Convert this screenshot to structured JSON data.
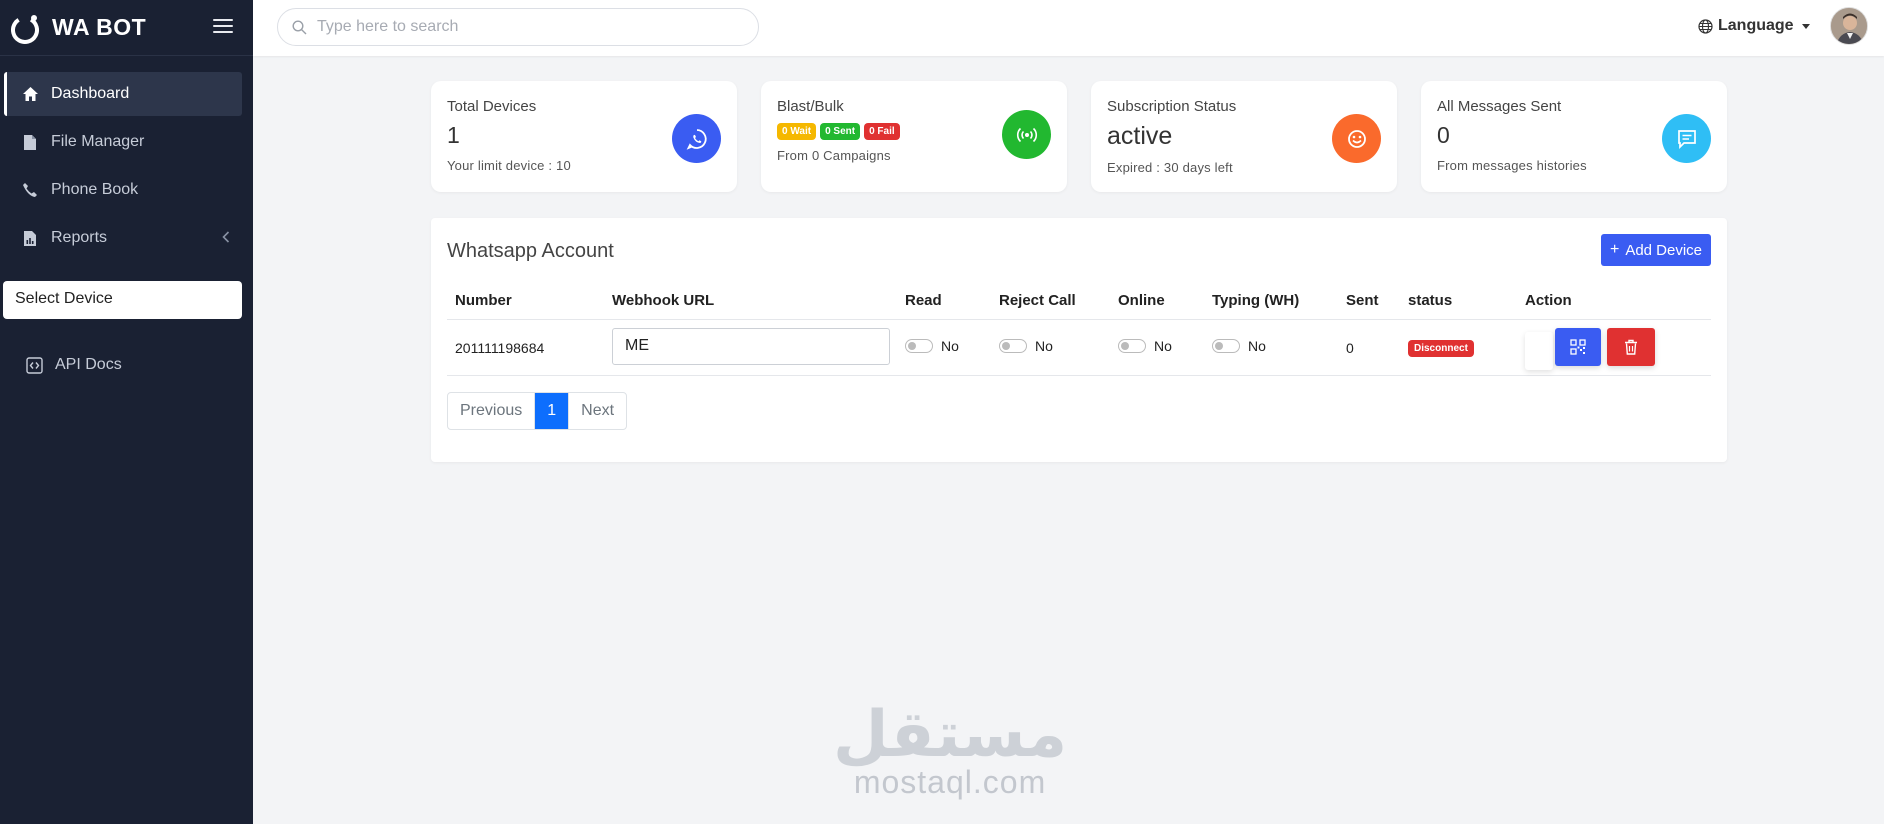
{
  "brand": {
    "name": "WA BOT"
  },
  "sidebar": {
    "items": [
      {
        "label": "Dashboard",
        "icon": "home-icon"
      },
      {
        "label": "File Manager",
        "icon": "file-icon"
      },
      {
        "label": "Phone Book",
        "icon": "phone-icon"
      },
      {
        "label": "Reports",
        "icon": "report-icon"
      }
    ],
    "select_device": "Select Device",
    "api_docs": "API Docs"
  },
  "header": {
    "search_placeholder": "Type here to search",
    "language_label": "Language"
  },
  "cards": [
    {
      "label": "Total Devices",
      "value": "1",
      "sub": "Your limit device : 10",
      "color": "#3a5cf2",
      "icon": "whatsapp-icon"
    },
    {
      "label": "Blast/Bulk",
      "badges": [
        "0 Wait",
        "0 Sent",
        "0 Fail"
      ],
      "sub": "From 0 Campaigns",
      "color": "#22b830",
      "icon": "broadcast-icon"
    },
    {
      "label": "Subscription Status",
      "value": "active",
      "sub": "Expired : 30 days left",
      "color": "#fa6a2c",
      "icon": "smile-icon"
    },
    {
      "label": "All Messages Sent",
      "value": "0",
      "sub": "From messages histories",
      "color": "#2fbef5",
      "icon": "message-icon"
    }
  ],
  "panel": {
    "title": "Whatsapp Account",
    "add_button": "Add Device",
    "columns": [
      "Number",
      "Webhook URL",
      "Read",
      "Reject Call",
      "Online",
      "Typing (WH)",
      "Sent",
      "status",
      "Action"
    ],
    "row": {
      "number": "201111198684",
      "webhook": "ME",
      "read": "No",
      "reject_call": "No",
      "online": "No",
      "typing": "No",
      "sent": "0",
      "status": "Disconnect"
    },
    "pagination": {
      "previous": "Previous",
      "current": "1",
      "next": "Next"
    }
  },
  "watermark": {
    "arabic": "مستقل",
    "latin": "mostaql.com"
  }
}
